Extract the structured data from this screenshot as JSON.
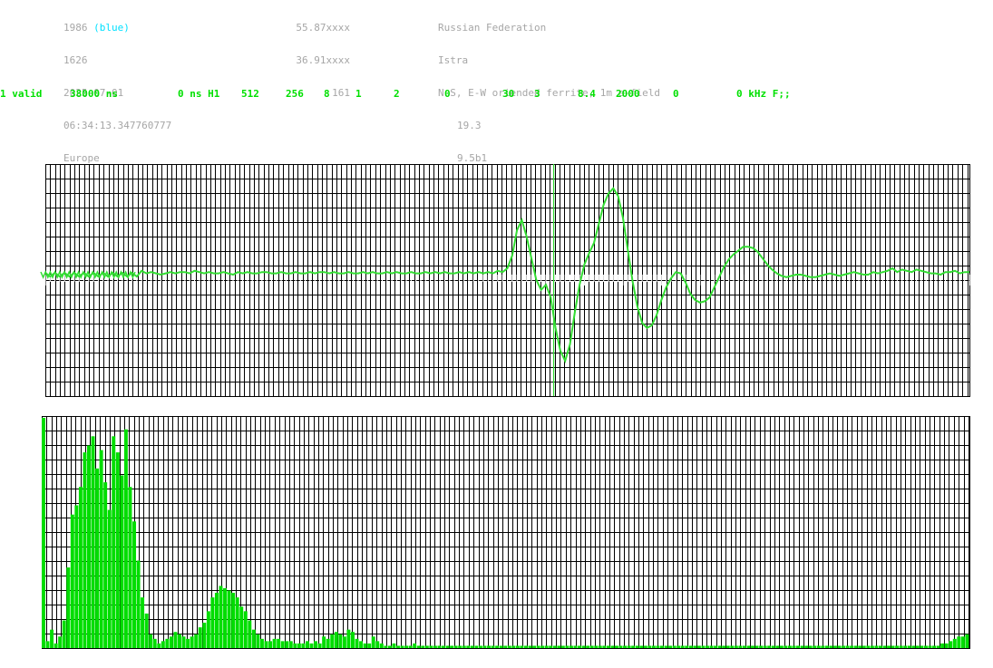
{
  "station": {
    "id": "1986",
    "color_label": "(blue)",
    "number": "1626",
    "date": "2025-07-01",
    "time": "06:34:13.347760777",
    "region": "Europe",
    "lat": "55.87xxxx",
    "lon": "36.91xxxx",
    "alt": "161",
    "country": "Russian Federation",
    "city": "Istra",
    "antenna": "N-S, E-W oriended ferrite, 1m e-field",
    "value1": "19.3",
    "value2": "9.5b1"
  },
  "status": {
    "valid": "1 valid",
    "duration": "38000 ns",
    "offset": "0 ns H1",
    "f1": "512",
    "f2": "256",
    "f3": "8",
    "f4": "1",
    "f5": "2",
    "f6": "0",
    "f7": "30",
    "f8": "3",
    "f9": "8.4",
    "f10": "2000",
    "f11": "0",
    "f12": "0 kHz F;;"
  },
  "colors": {
    "trace": "#33dd33",
    "grid": "#000000",
    "bars": "#00dd00",
    "info_text": "#a6a6a6",
    "status_text": "#00e000",
    "accent": "#00e0ff"
  },
  "chart_data": [
    {
      "type": "line",
      "title": "",
      "xlabel": "",
      "ylabel": "",
      "grid": true,
      "note_marker_index": 106,
      "x_count": 190,
      "y": [
        0,
        0,
        0,
        0,
        0,
        0,
        0,
        0,
        0,
        0,
        0,
        0,
        0,
        0,
        0,
        0,
        0,
        0,
        0,
        0,
        0.3,
        0.1,
        0.2,
        0.1,
        0,
        0.1,
        0.2,
        0.1,
        0.2,
        0.2,
        0.1,
        0.3,
        0.2,
        0.1,
        0.2,
        0.1,
        0.1,
        0.2,
        0.1,
        0,
        0.2,
        0.1,
        0.2,
        0.1,
        0.1,
        0.2,
        0.2,
        0.1,
        0.1,
        0.2,
        0.1,
        0.1,
        0.2,
        0.1,
        0.1,
        0.2,
        0.1,
        0.2,
        0.2,
        0.1,
        0.2,
        0.1,
        0.1,
        0.2,
        0.1,
        0.1,
        0.2,
        0.1,
        0.2,
        0.1,
        0.1,
        0.2,
        0.1,
        0.2,
        0.1,
        0.1,
        0.2,
        0.1,
        0.1,
        0.2,
        0.1,
        0.2,
        0.1,
        0.2,
        0.1,
        0.1,
        0.2,
        0.1,
        0.2,
        0.1,
        0.2,
        0.1,
        0.2,
        0.1,
        0.3,
        0.2,
        0.5,
        1.5,
        3.5,
        4.3,
        3.0,
        1.3,
        -0.4,
        -1.2,
        -0.8,
        -1.8,
        -4.2,
        -6.0,
        -6.8,
        -5.5,
        -3.0,
        -0.8,
        0.8,
        1.7,
        2.5,
        4.0,
        5.5,
        6.4,
        6.8,
        6.2,
        4.5,
        2.0,
        -0.5,
        -2.5,
        -3.8,
        -4.2,
        -4.0,
        -3.2,
        -2.0,
        -1.0,
        -0.3,
        0.2,
        0.1,
        -0.6,
        -1.5,
        -2.0,
        -2.2,
        -2.1,
        -1.8,
        -1.0,
        -0.2,
        0.6,
        1.2,
        1.6,
        1.9,
        2.2,
        2.2,
        2.1,
        1.8,
        1.3,
        0.8,
        0.4,
        0.1,
        -0.1,
        -0.2,
        -0.1,
        0,
        0,
        -0.1,
        -0.2,
        -0.2,
        -0.1,
        0,
        0.1,
        0,
        -0.1,
        0,
        0.1,
        0.2,
        0.1,
        0,
        0,
        0.2,
        0.1,
        0.2,
        0.3,
        0.5,
        0.2,
        0.4,
        0.3,
        0.2,
        0.4,
        0.3,
        0.2,
        0.1,
        0.1,
        0,
        0.2,
        0.2,
        0.3,
        0.1,
        0.2,
        0.2
      ]
    },
    {
      "type": "bar",
      "title": "",
      "xlabel": "",
      "ylabel": "",
      "grid": true,
      "ylim": [
        0,
        100
      ],
      "values": [
        100,
        3,
        8,
        2,
        5,
        12,
        35,
        58,
        62,
        70,
        85,
        88,
        92,
        78,
        86,
        72,
        60,
        92,
        85,
        75,
        95,
        70,
        55,
        38,
        22,
        15,
        6,
        4,
        2,
        3,
        4,
        5,
        7,
        6,
        5,
        4,
        5,
        6,
        9,
        11,
        16,
        22,
        24,
        27,
        26,
        25,
        24,
        22,
        18,
        16,
        12,
        8,
        6,
        4,
        3,
        3,
        4,
        4,
        3,
        3,
        3,
        2,
        2,
        2,
        3,
        2,
        3,
        2,
        5,
        4,
        6,
        7,
        6,
        5,
        8,
        7,
        4,
        3,
        2,
        2,
        5,
        3,
        2,
        1,
        1,
        2,
        1,
        1,
        1,
        1,
        2,
        1,
        1,
        1,
        1,
        1,
        1,
        1,
        1,
        1,
        1,
        1,
        1,
        1,
        1,
        1,
        1,
        1,
        1,
        1,
        1,
        1,
        1,
        1,
        1,
        1,
        1,
        1,
        1,
        1,
        1,
        1,
        1,
        1,
        1,
        1,
        1,
        1,
        1,
        1,
        1,
        1,
        1,
        1,
        1,
        1,
        1,
        1,
        1,
        1,
        1,
        1,
        1,
        1,
        1,
        1,
        1,
        1,
        1,
        1,
        1,
        1,
        1,
        1,
        1,
        1,
        1,
        1,
        1,
        1,
        1,
        1,
        1,
        1,
        1,
        1,
        1,
        1,
        1,
        1,
        1,
        1,
        1,
        1,
        1,
        1,
        1,
        1,
        1,
        1,
        1,
        1,
        1,
        1,
        1,
        1,
        1,
        1,
        1,
        1,
        1,
        1,
        1,
        1,
        1,
        1,
        1,
        1,
        1,
        1,
        1,
        1,
        1,
        1,
        1,
        1,
        1,
        1,
        1,
        1,
        1,
        1,
        1,
        1,
        1,
        1,
        1,
        1,
        2,
        2,
        3,
        4,
        5,
        5,
        6
      ]
    }
  ]
}
